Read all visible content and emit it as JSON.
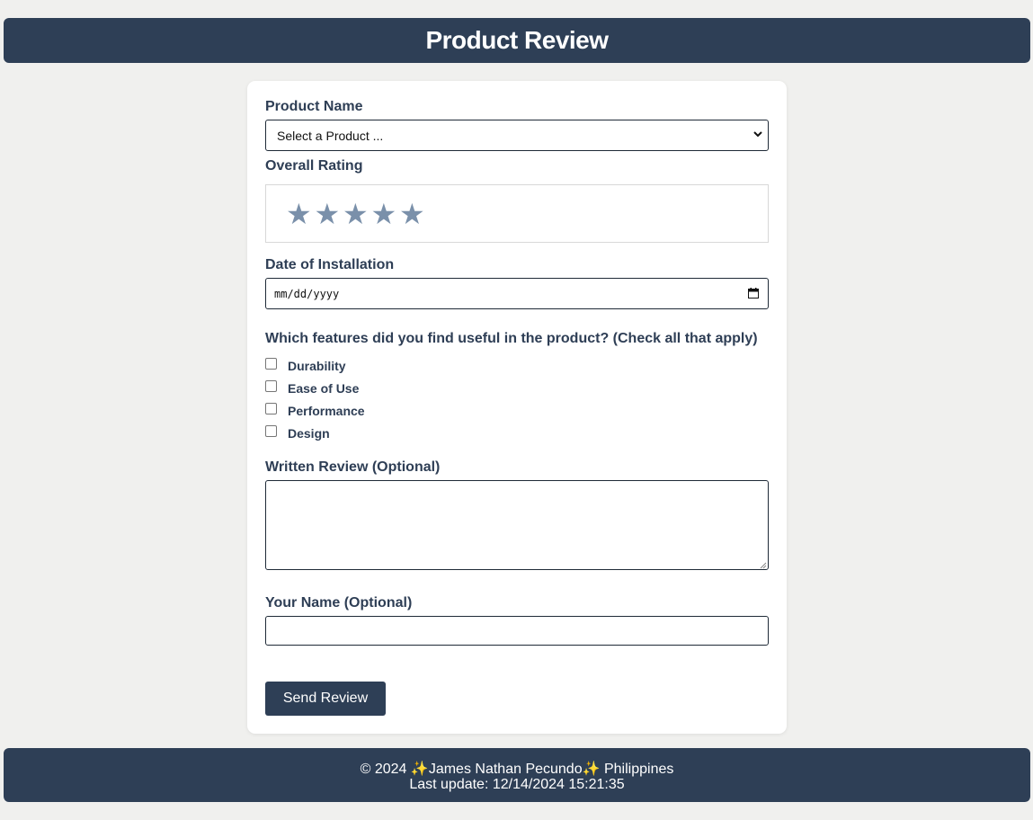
{
  "header": {
    "title": "Product Review"
  },
  "form": {
    "product": {
      "label": "Product Name",
      "selected": "Select a Product ..."
    },
    "rating": {
      "label": "Overall Rating",
      "stars": [
        "★",
        "★",
        "★",
        "★",
        "★"
      ],
      "selected": 0
    },
    "date": {
      "label": "Date of Installation",
      "placeholder": "mm/dd/yyyy"
    },
    "features": {
      "label": "Which features did you find useful in the product? (Check all that apply)",
      "options": [
        "Durability",
        "Ease of Use",
        "Performance",
        "Design"
      ]
    },
    "review": {
      "label": "Written Review (Optional)",
      "value": ""
    },
    "name": {
      "label": "Your Name (Optional)",
      "value": ""
    },
    "submit_label": "Send Review"
  },
  "footer": {
    "copyright": "© 2024",
    "sparkle": "✨",
    "author": "James Nathan Pecundo",
    "country": "Philippines",
    "last_update": "Last update: 12/14/2024 15:21:35"
  },
  "colors": {
    "primary": "#2e3f56",
    "background": "#f0f0ee",
    "star": "#7a90aa",
    "sparkle": "#f3c341"
  }
}
